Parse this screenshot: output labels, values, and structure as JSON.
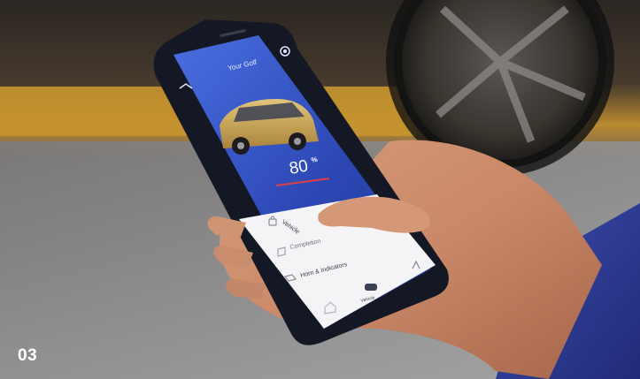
{
  "figure_number": "03",
  "app": {
    "title": "Your Golf",
    "speed_value": "80",
    "speed_unit": "%",
    "menu_items": [
      {
        "label": "Vehicle",
        "icon": "lock-icon"
      },
      {
        "label": "Completion",
        "icon": "plug-icon"
      },
      {
        "label": "Horn & Indicators",
        "icon": "horn-icon"
      }
    ],
    "bottom_nav": [
      {
        "label": "",
        "icon": "home-icon"
      },
      {
        "label": "Vehicle",
        "icon": "car-icon"
      },
      {
        "label": "",
        "icon": "profile-icon"
      }
    ]
  },
  "colors": {
    "screen_blue": "#2f4fc0",
    "car_gold": "#c8a456",
    "accent_red": "#e04040",
    "panel_white": "#f4f4f6"
  }
}
